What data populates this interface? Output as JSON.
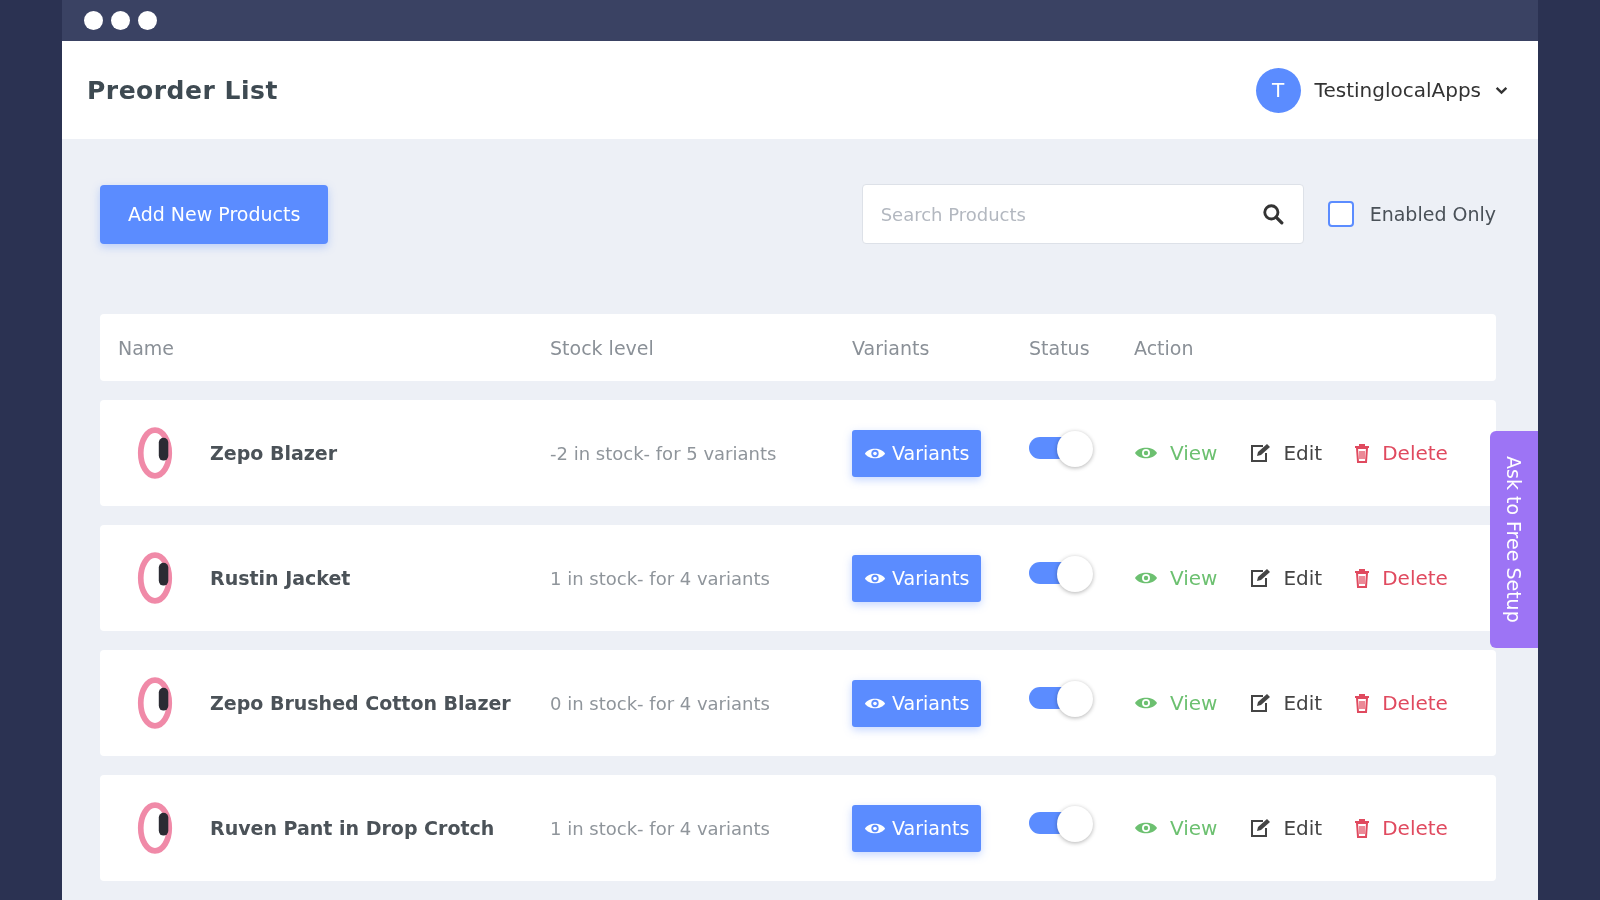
{
  "window": {
    "title": "Preorder List"
  },
  "user": {
    "initial": "T",
    "name": "TestinglocalApps"
  },
  "toolbar": {
    "add_button": "Add New Products",
    "search": {
      "placeholder": "Search Products"
    },
    "enabled_only": {
      "label": "Enabled Only",
      "checked": false
    }
  },
  "table": {
    "columns": [
      "Name",
      "Stock level",
      "Variants",
      "Status",
      "Action"
    ],
    "rows": [
      {
        "name": "Zepo Blazer",
        "stock": "-2 in stock- for 5 variants",
        "variants": "Variants",
        "enabled": true,
        "actions": [
          "View",
          "Edit",
          "Delete"
        ]
      },
      {
        "name": "Rustin Jacket",
        "stock": "1 in stock- for 4 variants",
        "variants": "Variants",
        "enabled": true,
        "actions": [
          "View",
          "Edit",
          "Delete"
        ]
      },
      {
        "name": "Zepo Brushed Cotton Blazer",
        "stock": "0 in stock- for 4 variants",
        "variants": "Variants",
        "enabled": true,
        "actions": [
          "View",
          "Edit",
          "Delete"
        ]
      },
      {
        "name": "Ruven Pant in Drop Crotch",
        "stock": "1 in stock- for 4 variants",
        "variants": "Variants",
        "enabled": true,
        "actions": [
          "View",
          "Edit",
          "Delete"
        ]
      }
    ]
  },
  "side_tab": {
    "label": "Ask to Free Setup"
  }
}
